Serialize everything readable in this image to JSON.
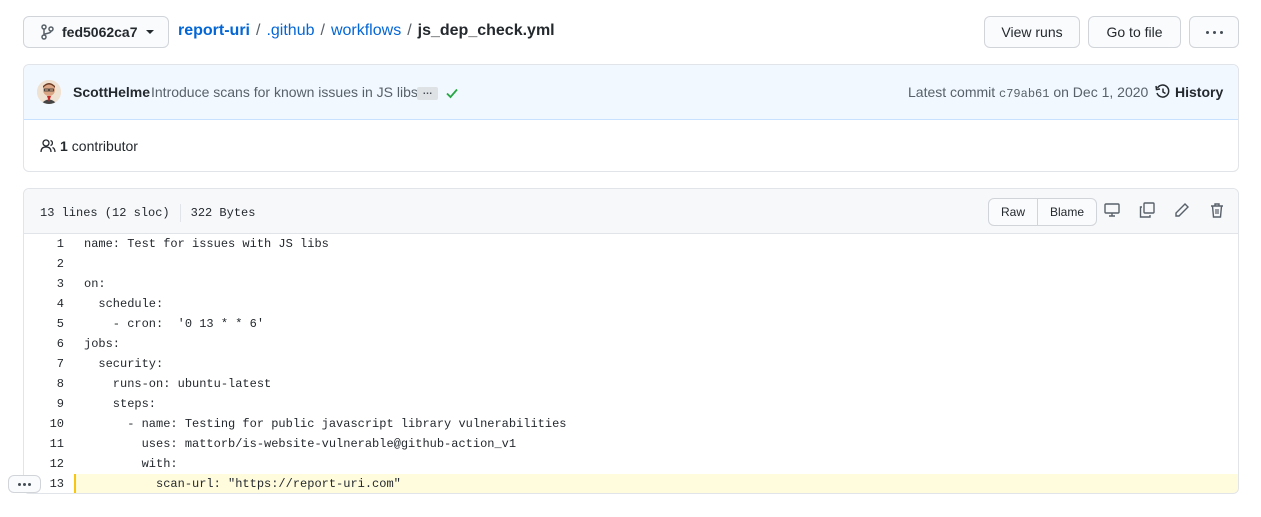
{
  "branch": {
    "name": "fed5062ca7"
  },
  "breadcrumb": {
    "repo": "report-uri",
    "dir1": ".github",
    "dir2": "workflows",
    "file": "js_dep_check.yml",
    "separator": "/"
  },
  "actions": {
    "view_runs": "View runs",
    "go_to_file": "Go to file"
  },
  "commit": {
    "author": "ScottHelme",
    "message": "Introduce scans for known issues in JS libs.",
    "ellipsis": "…",
    "latest_label": "Latest commit",
    "sha": "c79ab61",
    "date": "on Dec 1, 2020",
    "history_label": "History",
    "status_color": "#28a745"
  },
  "contributors": {
    "count": "1",
    "label": "contributor"
  },
  "file": {
    "lines_info": "13 lines (12 sloc)",
    "size": "322 Bytes",
    "raw_label": "Raw",
    "blame_label": "Blame"
  },
  "code_lines": [
    {
      "num": "1",
      "text": "name: Test for issues with JS libs"
    },
    {
      "num": "2",
      "text": ""
    },
    {
      "num": "3",
      "text": "on:"
    },
    {
      "num": "4",
      "text": "  schedule:"
    },
    {
      "num": "5",
      "text": "    - cron:  '0 13 * * 6'"
    },
    {
      "num": "6",
      "text": "jobs:"
    },
    {
      "num": "7",
      "text": "  security:"
    },
    {
      "num": "8",
      "text": "    runs-on: ubuntu-latest"
    },
    {
      "num": "9",
      "text": "    steps:"
    },
    {
      "num": "10",
      "text": "      - name: Testing for public javascript library vulnerabilities"
    },
    {
      "num": "11",
      "text": "        uses: mattorb/is-website-vulnerable@github-action_v1"
    },
    {
      "num": "12",
      "text": "        with:"
    },
    {
      "num": "13",
      "text": "          scan-url: \"https://report-uri.com\""
    }
  ],
  "highlighted_line": "13",
  "colors": {
    "link": "#0366d6",
    "highlight_bg": "#fffbdd",
    "highlight_bar": "#f9c513"
  }
}
